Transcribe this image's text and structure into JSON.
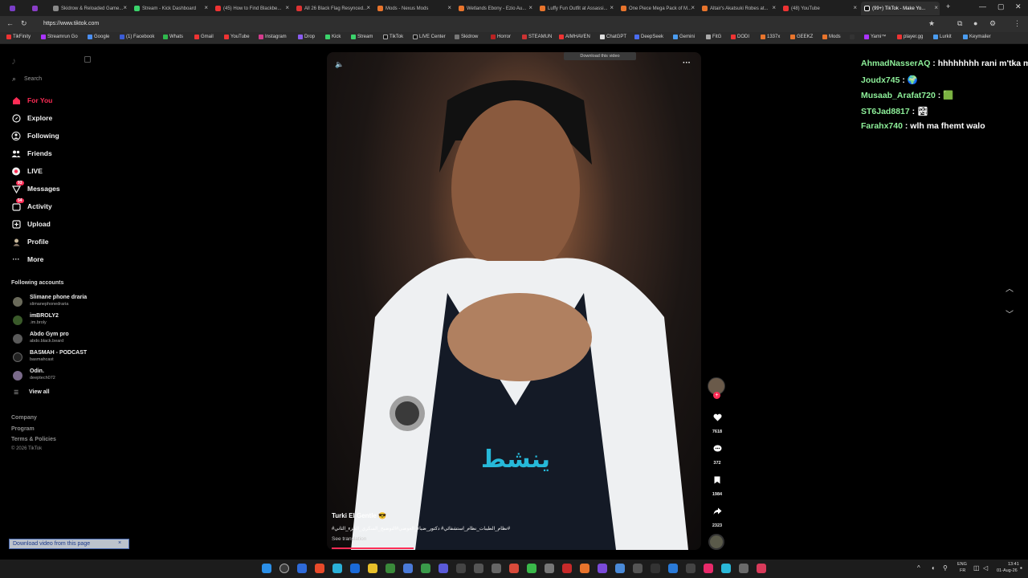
{
  "browser": {
    "tabs": [
      {
        "label": ""
      },
      {
        "label": ""
      },
      {
        "label": "Skidrow & Reloaded Game..."
      },
      {
        "label": "Stream - Kick Dashboard"
      },
      {
        "label": "(45) How to Find Blackbe..."
      },
      {
        "label": "All 26 Black Flag Resynced..."
      },
      {
        "label": "Mods - Nexus Mods"
      },
      {
        "label": "Wetlands Ebony - Ezio Au..."
      },
      {
        "label": "Luffy Fun Outfit at Assassi..."
      },
      {
        "label": "One Piece Mega Pack of M..."
      },
      {
        "label": "Altair's Akatsuki Robes at..."
      },
      {
        "label": "(48) YouTube"
      },
      {
        "label": "(99+) TikTok - Make Yo..."
      }
    ],
    "url": "https://www.tiktok.com",
    "bookmarks": [
      "TikFinity",
      "Streamrun Go",
      "Google",
      "(1) Facebook",
      "Whats",
      "Gmail",
      "YouTube",
      "Instagram",
      "Drop",
      "Kick",
      "Stream",
      "TikTok",
      "LIVE Center",
      "Skidrow",
      "Horror",
      "STEAMUN",
      "AIMHAVEN",
      "ChatGPT",
      "DeepSeek",
      "Gemini",
      "FitG",
      "DODI",
      "1337x",
      "GEEKZ",
      "Mods",
      "",
      "Yami™",
      "player.gg",
      "Lurkit",
      "Keymailer"
    ]
  },
  "sidebar": {
    "search_placeholder": "Search",
    "nav": [
      {
        "label": "For You"
      },
      {
        "label": "Explore"
      },
      {
        "label": "Following"
      },
      {
        "label": "Friends"
      },
      {
        "label": "LIVE"
      },
      {
        "label": "Messages",
        "badge": "93"
      },
      {
        "label": "Activity",
        "badge": "54"
      },
      {
        "label": "Upload"
      },
      {
        "label": "Profile"
      },
      {
        "label": "More"
      }
    ],
    "following_title": "Following accounts",
    "accounts": [
      {
        "name": "Slimane phone draria",
        "handle": "slimanephonedraria"
      },
      {
        "name": "imBROLY2",
        "handle": ".im.broly"
      },
      {
        "name": "Abdo Gym pro",
        "handle": "abdo.black.beard"
      },
      {
        "name": "BASMAH - PODCAST",
        "handle": "basmahcast"
      },
      {
        "name": "Odin.",
        "handle": "deeptech072"
      }
    ],
    "view_all": "View all",
    "footer": [
      "Company",
      "Program",
      "Terms & Policies",
      "© 2026 TikTok"
    ]
  },
  "video": {
    "download_top": "Download this video",
    "caption_overlay": "ينشط",
    "author": "Turki El Gentle 😎",
    "description": "#نظام_الطيبات_نظام_استشفائي# دكتور_ضياء_العوضي#التوضيح_السكري_الجزء_الثاني#",
    "see_translation": "See translation",
    "likes": "7618",
    "comments": "372",
    "saves": "1984",
    "shares": "2323"
  },
  "chat": [
    {
      "user": "AhmadNasserAQ",
      "msg": "hhhhhhhh rani m'tka m3"
    },
    {
      "user": "Joudx745",
      "msg": "🌍"
    },
    {
      "user": "Musaab_Arafat720",
      "msg": "🟩"
    },
    {
      "user": "ST6Jad8817",
      "msg": "🏞"
    },
    {
      "user": "Farahx740",
      "msg": "wlh ma fhemt walo"
    }
  ],
  "download_bottom": "Download video from this page",
  "taskbar": {
    "lang_top": "ENG",
    "lang_bottom": "FR",
    "time": "13:41",
    "date": "01-Aug-26"
  }
}
